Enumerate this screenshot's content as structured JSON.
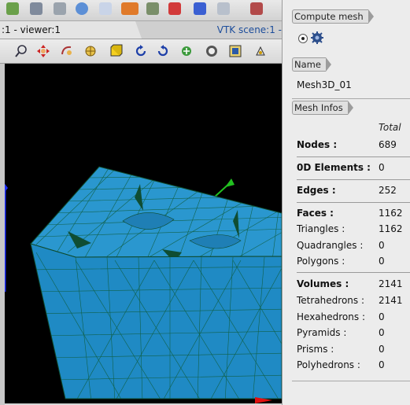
{
  "viewer": {
    "tab_label": ":1 - viewer:1",
    "vtk_tab_label": "VTK scene:1 -"
  },
  "panel": {
    "compute_section_label": "Compute mesh",
    "name_section_label": "Name",
    "mesh_name": "Mesh3D_01",
    "infos_section_label": "Mesh Infos",
    "total_header": "Total",
    "rows": [
      {
        "label": "Nodes :",
        "value": "689"
      },
      {
        "label": "0D Elements :",
        "value": "0"
      },
      {
        "label": "Edges :",
        "value": "252"
      },
      {
        "label": "Faces :",
        "value": "1162"
      },
      {
        "label": "Triangles :",
        "value": "1162"
      },
      {
        "label": "Quadrangles :",
        "value": "0"
      },
      {
        "label": "Polygons :",
        "value": "0"
      },
      {
        "label": "Volumes :",
        "value": "2141"
      },
      {
        "label": "Tetrahedrons :",
        "value": "2141"
      },
      {
        "label": "Hexahedrons :",
        "value": "0"
      },
      {
        "label": "Pyramids :",
        "value": "0"
      },
      {
        "label": "Prisms :",
        "value": "0"
      },
      {
        "label": "Polyhedrons :",
        "value": "0"
      }
    ]
  },
  "colors": {
    "mesh_fill": "#1f8ac4",
    "mesh_edge": "#0d4a2c",
    "viewport_bg": "#000000",
    "axis_x": "#e01010",
    "axis_y": "#22c020",
    "axis_z": "#2030ff"
  },
  "icons": {
    "viewer_toolbar": [
      "zoom-icon",
      "pan-icon",
      "rotate-icon",
      "global-pan-icon",
      "fit-all-icon",
      "rotate-ccw-icon",
      "rotate-cw-icon",
      "reset-view-icon",
      "dump-view-icon",
      "clipping-icon",
      "trihedron-icon"
    ]
  }
}
